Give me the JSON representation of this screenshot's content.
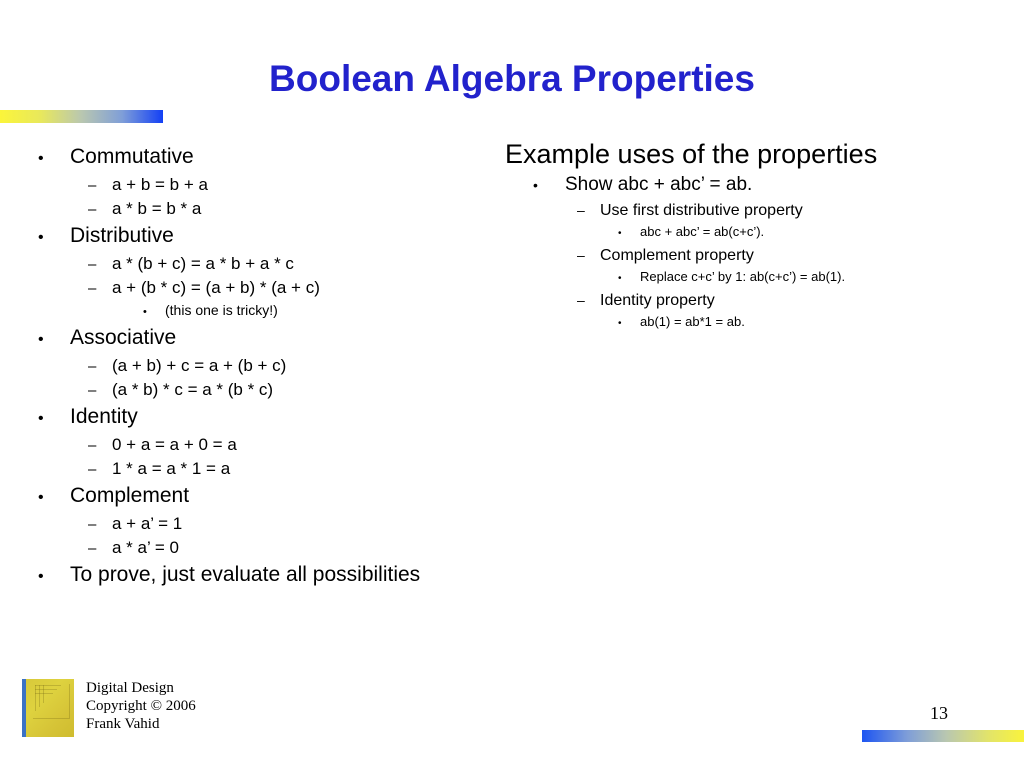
{
  "slide": {
    "title": "Boolean Algebra Properties",
    "page_number": "13",
    "title_color": "#2222CC",
    "background_color": "#FFFFFF"
  },
  "left_column": {
    "items": [
      {
        "level": 1,
        "text": "Commutative"
      },
      {
        "level": 2,
        "text": "a + b = b + a"
      },
      {
        "level": 2,
        "text": "a * b = b * a"
      },
      {
        "level": 1,
        "text": "Distributive"
      },
      {
        "level": 2,
        "text": "a * (b + c) = a * b + a * c"
      },
      {
        "level": 2,
        "text": "a + (b * c) = (a + b) * (a + c)"
      },
      {
        "level": 3,
        "text": "(this one is tricky!)"
      },
      {
        "level": 1,
        "text": "Associative"
      },
      {
        "level": 2,
        "text": "(a + b) + c = a + (b + c)"
      },
      {
        "level": 2,
        "text": "(a * b) * c = a * (b * c)"
      },
      {
        "level": 1,
        "text": "Identity"
      },
      {
        "level": 2,
        "text": "0 + a = a + 0 = a"
      },
      {
        "level": 2,
        "text": "1 * a = a * 1 = a"
      },
      {
        "level": 1,
        "text": "Complement"
      },
      {
        "level": 2,
        "text": "a + a’ = 1"
      },
      {
        "level": 2,
        "text": "a * a’ = 0"
      },
      {
        "level": 1,
        "text": "To prove, just evaluate all possibilities"
      }
    ]
  },
  "right_column": {
    "heading": "Example uses of the properties",
    "items": [
      {
        "level": 1,
        "text": "Show abc + abc’ = ab."
      },
      {
        "level": 2,
        "text": "Use first distributive property"
      },
      {
        "level": 3,
        "text": "abc + abc’ = ab(c+c’)."
      },
      {
        "level": 2,
        "text": "Complement property"
      },
      {
        "level": 3,
        "text": "Replace c+c’ by 1: ab(c+c’) = ab(1)."
      },
      {
        "level": 2,
        "text": "Identity property"
      },
      {
        "level": 3,
        "text": "ab(1) = ab*1 = ab."
      }
    ]
  },
  "footer": {
    "line1": "Digital Design",
    "line2": "Copyright © 2006",
    "line3": "Frank Vahid"
  },
  "glyphs": {
    "bullet_dot": "•",
    "bullet_dash": "–"
  }
}
